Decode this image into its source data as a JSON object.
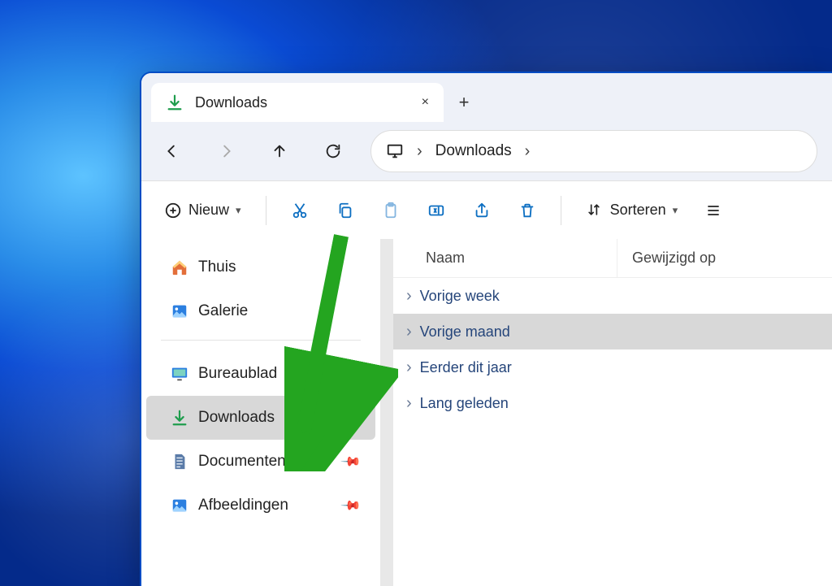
{
  "tab": {
    "title": "Downloads",
    "close": "×",
    "new": "+"
  },
  "nav": {
    "back": "←",
    "forward": "→",
    "up": "↑",
    "refresh": "⟳"
  },
  "breadcrumb": {
    "location": "Downloads"
  },
  "toolbar": {
    "new_label": "Nieuw",
    "sort_label": "Sorteren"
  },
  "sidebar": {
    "home": "Thuis",
    "gallery": "Galerie",
    "desktop": "Bureaublad",
    "downloads": "Downloads",
    "documents": "Documenten",
    "pictures": "Afbeeldingen"
  },
  "columns": {
    "name": "Naam",
    "modified": "Gewijzigd op"
  },
  "groups": {
    "g1": "Vorige week",
    "g2": "Vorige maand",
    "g3": "Eerder dit jaar",
    "g4": "Lang geleden"
  }
}
